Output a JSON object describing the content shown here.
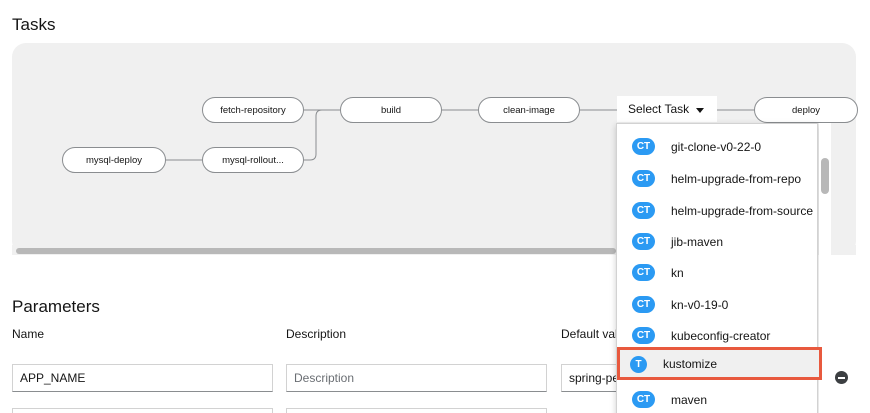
{
  "tasks_title": "Tasks",
  "parameters_title": "Parameters",
  "pipeline": {
    "nodes": {
      "mysql_deploy": "mysql-deploy",
      "mysql_rollout": "mysql-rollout...",
      "fetch_repository": "fetch-repository",
      "build": "build",
      "clean_image": "clean-image",
      "deploy": "deploy"
    },
    "select_task_label": "Select Task"
  },
  "task_dropdown": {
    "items": [
      {
        "badge": "CT",
        "label": "git-clone-v0-22-0"
      },
      {
        "badge": "CT",
        "label": "helm-upgrade-from-repo"
      },
      {
        "badge": "CT",
        "label": "helm-upgrade-from-source"
      },
      {
        "badge": "CT",
        "label": "jib-maven"
      },
      {
        "badge": "CT",
        "label": "kn"
      },
      {
        "badge": "CT",
        "label": "kn-v0-19-0"
      },
      {
        "badge": "CT",
        "label": "kubeconfig-creator"
      },
      {
        "badge": "T",
        "label": "kustomize"
      },
      {
        "badge": "CT",
        "label": "maven"
      }
    ],
    "highlight_color": "#e8593e",
    "badge_color": "#2b9af3"
  },
  "parameters": {
    "columns": {
      "name": "Name",
      "description": "Description",
      "default_value": "Default val"
    },
    "rows": [
      {
        "name": "APP_NAME",
        "description_placeholder": "Description",
        "default_value": "spring-pe"
      }
    ]
  }
}
